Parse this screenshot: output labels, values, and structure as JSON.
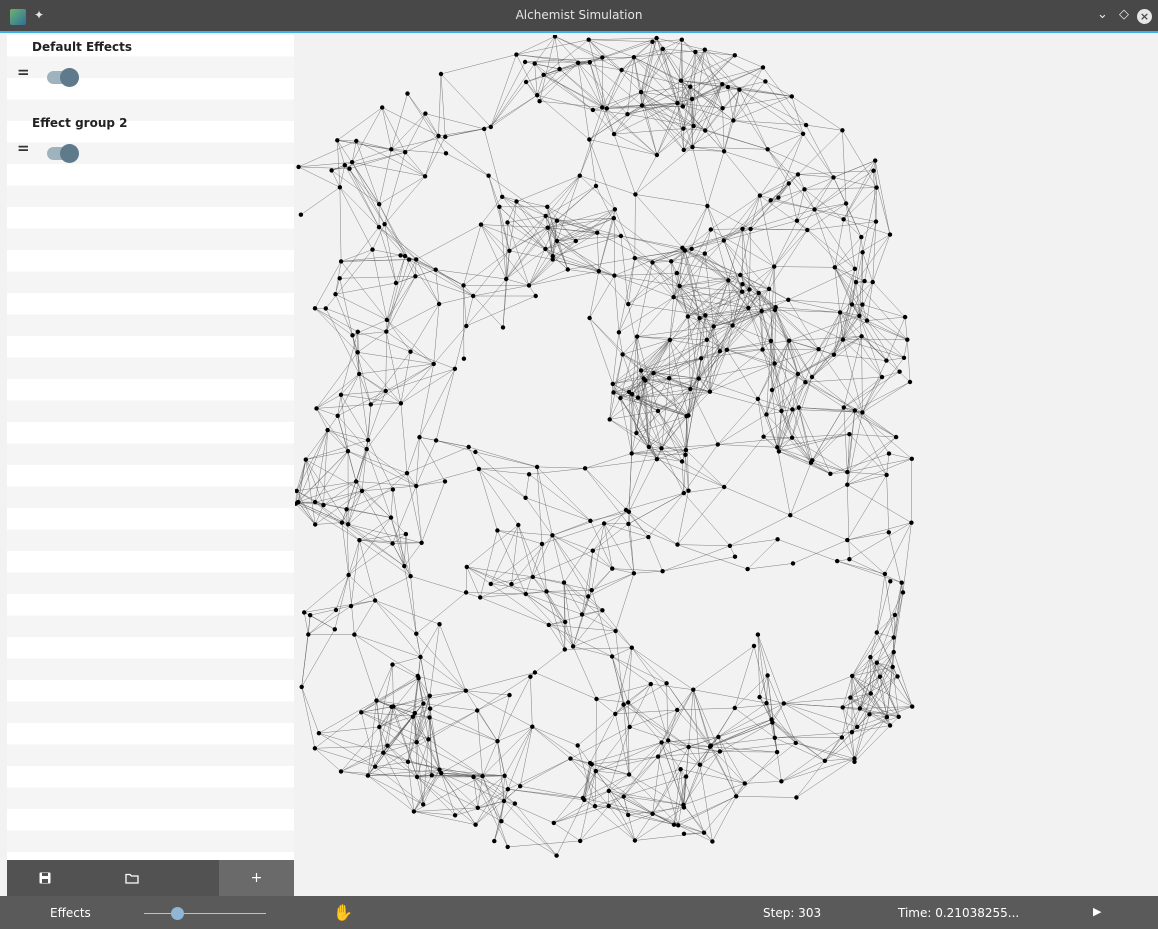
{
  "window": {
    "title": "Alchemist Simulation",
    "minimize_icon": "chevron-down-icon",
    "maximize_icon": "diamond-icon",
    "close_icon": "close-circle-icon"
  },
  "sidebar": {
    "groups": [
      {
        "name": "Default Effects",
        "enabled": true,
        "drag_icon": "drag-handle-icon"
      },
      {
        "name": "Effect group 2",
        "enabled": true,
        "drag_icon": "drag-handle-icon"
      }
    ],
    "toolbar": {
      "save_icon": "save-icon",
      "open_icon": "folder-icon",
      "add_label": "+"
    }
  },
  "bottom": {
    "effects_label": "Effects",
    "slider_value": 0.27,
    "pan_icon": "hand-icon",
    "step": "Step: 303",
    "time": "Time: 0.21038255...",
    "play_icon": "play-icon"
  },
  "canvas": {
    "node_color": "#000000",
    "edge_color": "#555555",
    "background": "#f2f2f2"
  }
}
